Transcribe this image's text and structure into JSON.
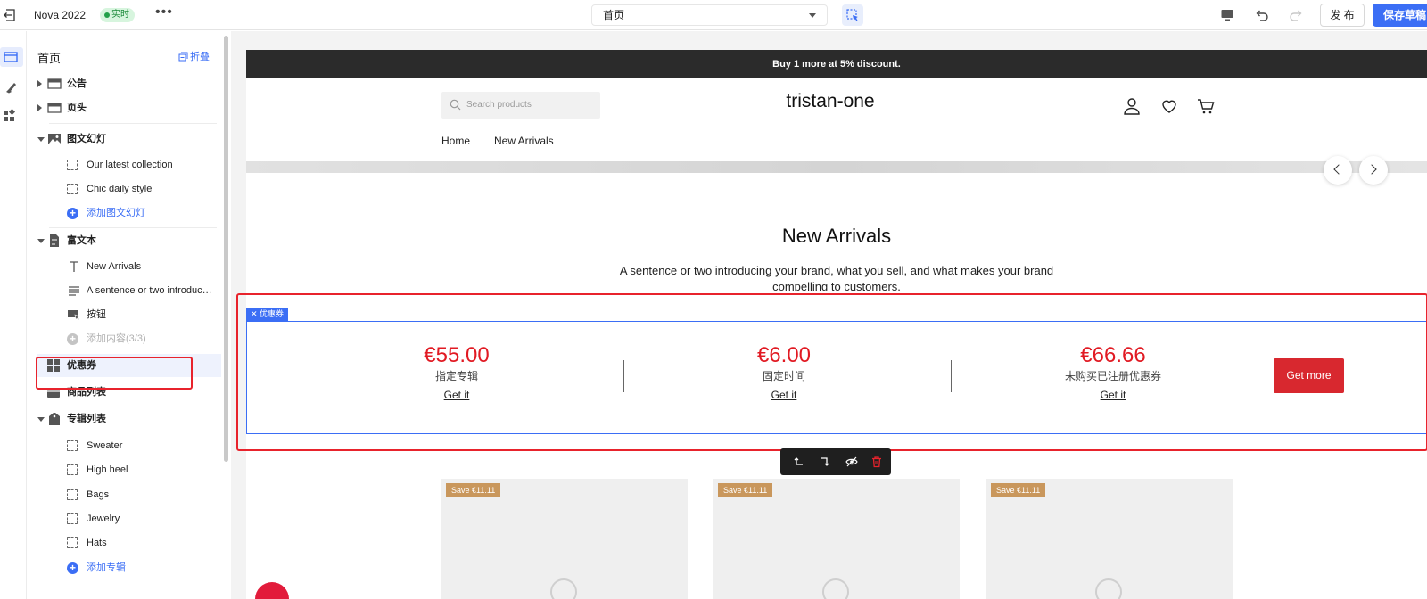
{
  "topbar": {
    "title": "Nova 2022",
    "badge": "实时",
    "more": "•••",
    "page_select": "首页",
    "publish": "发 布",
    "save": "保存草稿"
  },
  "sidebar": {
    "title": "首页",
    "collapse": "折叠",
    "items": [
      {
        "label": "公告"
      },
      {
        "label": "页头"
      },
      {
        "label": "图文幻灯"
      },
      {
        "label": "Our latest collection"
      },
      {
        "label": "Chic daily style"
      },
      {
        "label": "添加图文幻灯"
      },
      {
        "label": "富文本"
      },
      {
        "label": "New Arrivals"
      },
      {
        "label": "A sentence or two introducing your brand"
      },
      {
        "label": "按钮"
      },
      {
        "label": "添加内容(3/3)"
      },
      {
        "label": "优惠券"
      },
      {
        "label": "商品列表"
      },
      {
        "label": "专辑列表"
      },
      {
        "label": "Sweater"
      },
      {
        "label": "High heel"
      },
      {
        "label": "Bags"
      },
      {
        "label": "Jewelry"
      },
      {
        "label": "Hats"
      },
      {
        "label": "添加专辑"
      }
    ]
  },
  "store": {
    "announcement": "Buy 1 more at 5% discount.",
    "search_placeholder": "Search products",
    "brand": "tristan-one",
    "nav": [
      "Home",
      "New Arrivals"
    ],
    "richtext_title": "New Arrivals",
    "richtext_body": "A sentence or two introducing your brand, what you sell, and what makes your brand compelling to customers.",
    "coupon_tag": "优惠券",
    "coupons": [
      {
        "amount": "€55.00",
        "name": "指定专辑",
        "action": "Get it"
      },
      {
        "amount": "€6.00",
        "name": "固定时间",
        "action": "Get it"
      },
      {
        "amount": "€66.66",
        "name": "未购买已注册优惠券",
        "action": "Get it"
      }
    ],
    "get_more": "Get more",
    "product_tags": [
      "Save €11.11",
      "Save €11.11",
      "Save €11.11"
    ]
  },
  "colors": {
    "accent": "#3b6ef5",
    "annotation": "#e8232c",
    "coupon_amount": "#e11a23",
    "get_more_bg": "#d8282f",
    "product_tag_bg": "#c9975c"
  }
}
